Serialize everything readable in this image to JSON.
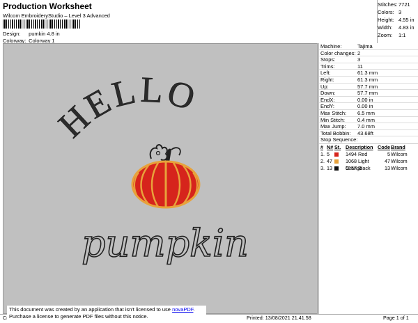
{
  "header": {
    "title": "Production Worksheet",
    "subtitle": "Wilcom EmbroideryStudio – Level 3 Advanced",
    "design_label": "Design:",
    "design_value": "pumkin 4.8 in",
    "colorway_label": "Colorway:",
    "colorway_value": "Colorway 1"
  },
  "stats": [
    {
      "label": "Stitches:",
      "value": "7721"
    },
    {
      "label": "Colors:",
      "value": "3"
    },
    {
      "label": "Height:",
      "value": "4.55 in"
    },
    {
      "label": "Width:",
      "value": "4.83 in"
    },
    {
      "label": "Zoom:",
      "value": "1:1"
    }
  ],
  "design_text": {
    "top": "HELLO",
    "bottom": "pumpkin"
  },
  "colors": {
    "canvas": "#c0c0c0",
    "thread_dark": "#2b2b2b",
    "pumpkin_red": "#d6241c",
    "pumpkin_orange": "#e8a23b"
  },
  "machine_info": [
    {
      "label": "Machine:",
      "value": "Tajima"
    },
    {
      "label": "Color changes:",
      "value": "2"
    },
    {
      "label": "Stops:",
      "value": "3"
    },
    {
      "label": "Trims:",
      "value": "11"
    },
    {
      "label": "Left:",
      "value": "61.3 mm"
    },
    {
      "label": "Right:",
      "value": "61.3 mm"
    },
    {
      "label": "Up:",
      "value": "57.7 mm"
    },
    {
      "label": "Down:",
      "value": "57.7 mm"
    },
    {
      "label": "EndX:",
      "value": "0.00 in"
    },
    {
      "label": "EndY:",
      "value": "0.00 in"
    },
    {
      "label": "Max Stitch:",
      "value": "6.5 mm"
    },
    {
      "label": "Min Stitch:",
      "value": "0.4 mm"
    },
    {
      "label": "Max Jump:",
      "value": "7.0 mm"
    },
    {
      "label": "Total Bobbin:",
      "value": "43.68ft"
    }
  ],
  "stop_sequence": {
    "title": "Stop Sequence:",
    "headers": [
      "#",
      "N#",
      "St.",
      "Description",
      "Code",
      "Brand"
    ],
    "rows": [
      {
        "num": "1.",
        "n": "5",
        "st": "1494",
        "desc": "Red",
        "code": "5",
        "brand": "Wilcom",
        "color": "#d6241c"
      },
      {
        "num": "2.",
        "n": "47",
        "st": "1068",
        "desc": "Light Orange",
        "code": "47",
        "brand": "Wilcom",
        "color": "#e8a23b"
      },
      {
        "num": "3.",
        "n": "13",
        "st": "5157",
        "desc": "Black",
        "code": "13",
        "brand": "Wilcom",
        "color": "#111111"
      }
    ]
  },
  "notice": {
    "line1_prefix": "This document was created by an application that isn't licensed to use ",
    "link": "novaPDF",
    "line1_suffix": ".",
    "line2": "Purchase a license to generate PDF files without this notice."
  },
  "footer": {
    "left": "Cr",
    "printed": "Printed: 13/08/2021 21.41.58",
    "page": "Page 1 of 1"
  }
}
